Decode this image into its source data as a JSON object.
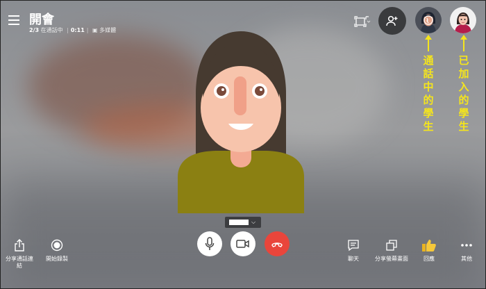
{
  "meeting": {
    "title": "開會",
    "participants": "2/3",
    "in_call_text": "在通話中",
    "duration": "0:11",
    "layout_text": "多媒體"
  },
  "annotations": {
    "in_call_label": "通話中的學生",
    "joined_label": "已加入的學生",
    "color": "#f5e51c"
  },
  "controls": {
    "hangup_color": "#e9453b"
  },
  "left_tools": [
    {
      "label": "分享通話連結",
      "icon": "share-icon"
    },
    {
      "label": "開始錄製",
      "icon": "record-icon"
    }
  ],
  "right_tools": [
    {
      "label": "聊天",
      "icon": "chat-icon"
    },
    {
      "label": "分享螢幕畫面",
      "icon": "screen-share-icon"
    },
    {
      "label": "回應",
      "icon": "thumbs-up-icon"
    },
    {
      "label": "其他",
      "icon": "more-icon"
    }
  ]
}
